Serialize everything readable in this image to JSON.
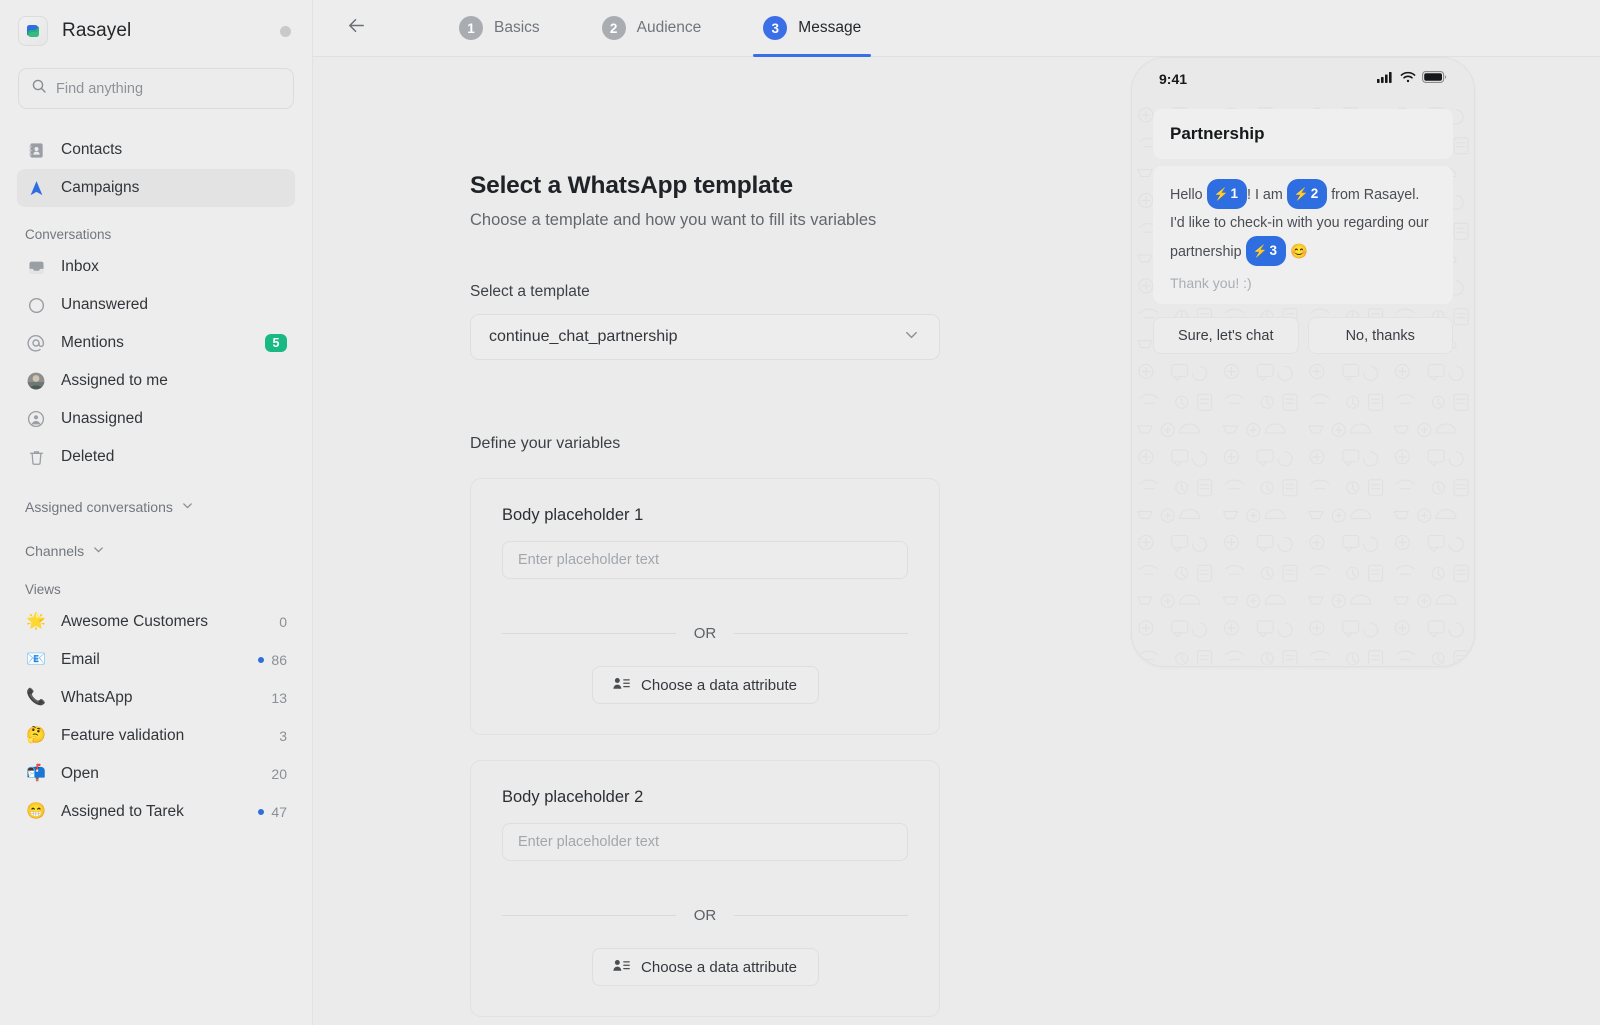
{
  "sidebar": {
    "brand": {
      "name": "Rasayel",
      "logo_icon": "rasayel-logo-icon",
      "status_dot": "presence-dot"
    },
    "search": {
      "placeholder": "Find anything",
      "value": "",
      "icon": "search-icon"
    },
    "primary_items": [
      {
        "label": "Contacts",
        "icon": "contacts-book-icon",
        "active": false
      },
      {
        "label": "Campaigns",
        "icon": "campaigns-send-icon",
        "active": true
      }
    ],
    "conversations_heading": "Conversations",
    "conversation_items": [
      {
        "label": "Inbox",
        "icon": "inbox-icon",
        "count": "",
        "dot": false
      },
      {
        "label": "Unanswered",
        "icon": "circle-outline-icon",
        "count": "",
        "dot": false
      },
      {
        "label": "Mentions",
        "icon": "at-mention-icon",
        "count": "5",
        "badge": true,
        "dot": false
      },
      {
        "label": "Assigned to me",
        "icon": "user-avatar-icon",
        "count": "",
        "dot": false
      },
      {
        "label": "Unassigned",
        "icon": "unassigned-user-icon",
        "count": "",
        "dot": false
      },
      {
        "label": "Deleted",
        "icon": "trash-icon",
        "count": "",
        "dot": false
      }
    ],
    "collapsibles": [
      {
        "label": "Assigned conversations",
        "icon": "chevron-down-icon"
      },
      {
        "label": "Channels",
        "icon": "chevron-down-icon"
      }
    ],
    "views_heading": "Views",
    "view_items": [
      {
        "label": "Awesome Customers",
        "emoji": "🌟",
        "count": "0",
        "dot": false
      },
      {
        "label": "Email",
        "emoji": "📧",
        "count": "86",
        "dot": true
      },
      {
        "label": "WhatsApp",
        "emoji": "📞",
        "count": "13",
        "dot": false
      },
      {
        "label": "Feature validation",
        "emoji": "🤔",
        "count": "3",
        "dot": false
      },
      {
        "label": "Open",
        "emoji": "📬",
        "count": "20",
        "dot": false
      },
      {
        "label": "Assigned to Tarek",
        "emoji": "😁",
        "count": "47",
        "dot": true
      }
    ]
  },
  "topbar": {
    "back_icon": "arrow-left-icon",
    "steps": [
      {
        "num": "1",
        "label": "Basics",
        "active": false
      },
      {
        "num": "2",
        "label": "Audience",
        "active": false
      },
      {
        "num": "3",
        "label": "Message",
        "active": true
      }
    ]
  },
  "main": {
    "title": "Select a WhatsApp template",
    "subtitle": "Choose a template and how you want to fill its variables",
    "template_field_label": "Select a template",
    "template_selected": "continue_chat_partnership",
    "template_caret_icon": "chevron-down-icon",
    "variables_heading": "Define your variables",
    "or_divider": "OR",
    "attribute_button_label": "Choose a data attribute",
    "attribute_button_icon": "contact-attribute-icon",
    "variables": [
      {
        "title": "Body placeholder 1",
        "value": "",
        "placeholder": "Enter placeholder text"
      },
      {
        "title": "Body placeholder 2",
        "value": "",
        "placeholder": "Enter placeholder text"
      }
    ]
  },
  "preview": {
    "status_time": "9:41",
    "status_icons": [
      "signal-bars-icon",
      "wifi-icon",
      "battery-icon"
    ],
    "header_bubble": "Partnership",
    "message_parts": [
      {
        "type": "text",
        "text": "Hello "
      },
      {
        "type": "var",
        "num": "1"
      },
      {
        "type": "text",
        "text": "! I am "
      },
      {
        "type": "var",
        "num": "2"
      },
      {
        "type": "text",
        "text": " from Rasayel. I'd like to check-in with you regarding our partnership "
      },
      {
        "type": "var",
        "num": "3"
      },
      {
        "type": "text",
        "text": " 😊"
      }
    ],
    "footer_text": "Thank you! :)",
    "quick_replies": [
      "Sure, let's chat",
      "No, thanks"
    ]
  },
  "colors": {
    "accent_blue": "#3b6fe8",
    "badge_green": "#18b982",
    "app_bg": "#ebebeb",
    "sidebar_bg": "#ededed",
    "bubble_bg": "#efefef"
  }
}
